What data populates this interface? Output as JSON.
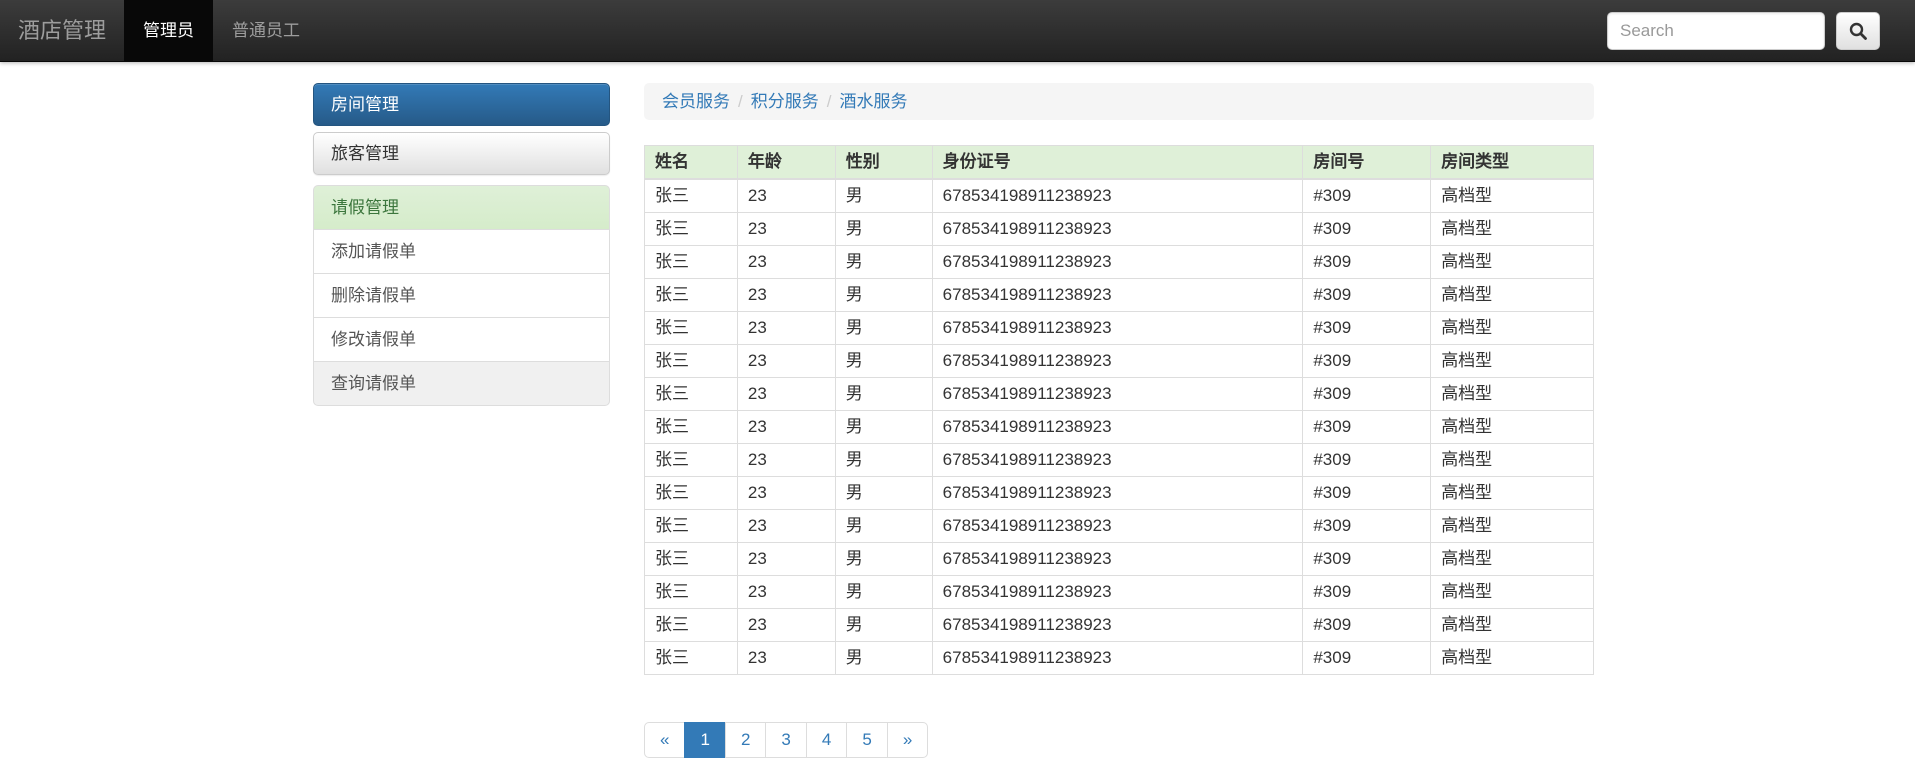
{
  "navbar": {
    "brand": "酒店管理",
    "items": [
      {
        "label": "管理员",
        "active": true
      },
      {
        "label": "普通员工",
        "active": false
      }
    ],
    "search": {
      "placeholder": "Search",
      "icon": "search-icon"
    }
  },
  "sidebar": {
    "buttons": [
      {
        "label": "房间管理",
        "style": "primary"
      },
      {
        "label": "旅客管理",
        "style": "default"
      }
    ],
    "list_group": [
      {
        "label": "请假管理",
        "style": "success"
      },
      {
        "label": "添加请假单",
        "style": "plain"
      },
      {
        "label": "删除请假单",
        "style": "plain"
      },
      {
        "label": "修改请假单",
        "style": "plain"
      },
      {
        "label": "查询请假单",
        "style": "muted"
      }
    ]
  },
  "breadcrumb": {
    "separator": "/",
    "items": [
      "会员服务",
      "积分服务",
      "酒水服务"
    ]
  },
  "table": {
    "headers": [
      "姓名",
      "年龄",
      "性别",
      "身份证号",
      "房间号",
      "房间类型"
    ],
    "row": [
      "张三",
      "23",
      "男",
      "678534198911238923",
      "#309",
      "高档型"
    ],
    "row_count": 15
  },
  "pagination": {
    "prev": "«",
    "pages": [
      "1",
      "2",
      "3",
      "4",
      "5"
    ],
    "active": "1",
    "next": "»"
  },
  "colors": {
    "primary": "#337ab7",
    "primary_dark": "#265a88",
    "success_bg": "#dff0d8",
    "success_text": "#3c763d",
    "navbar_bg": "#222222",
    "navbar_active_bg": "#080808",
    "navbar_text": "#9d9d9d",
    "border": "#dddddd",
    "breadcrumb_bg": "#f5f5f5"
  }
}
